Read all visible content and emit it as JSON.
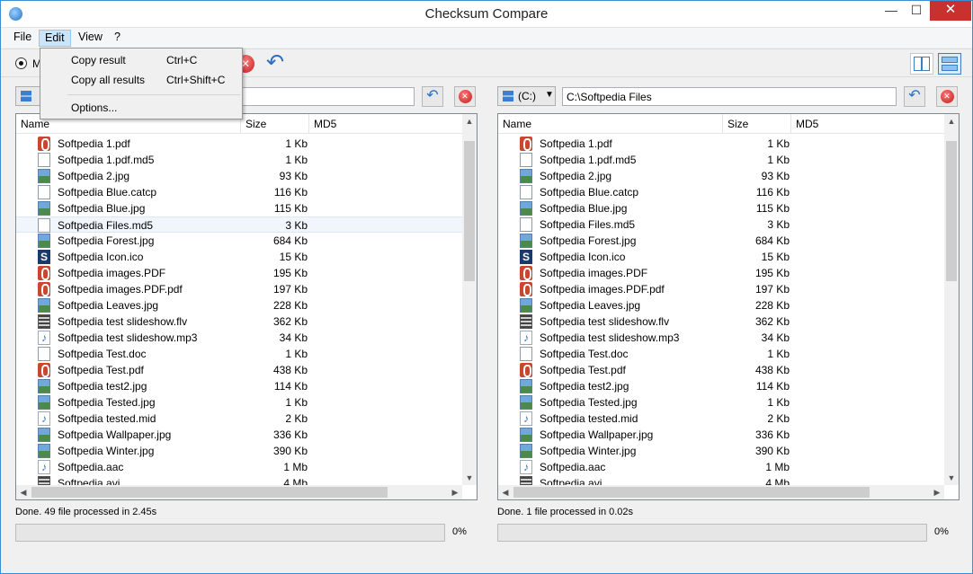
{
  "window": {
    "title": "Checksum Compare",
    "controls": {
      "minimize": "—",
      "maximize": "☐",
      "close": "✕"
    }
  },
  "menu": [
    "File",
    "Edit",
    "View",
    "?"
  ],
  "edit_menu": {
    "items": [
      {
        "label": "Copy result",
        "shortcut": "Ctrl+C"
      },
      {
        "label": "Copy all results",
        "shortcut": "Ctrl+Shift+C"
      },
      {
        "label": "Options...",
        "shortcut": ""
      }
    ]
  },
  "toolbar": {
    "mode_radio_label": "M"
  },
  "left_panel": {
    "drive": "",
    "path": "",
    "columns": [
      "Name",
      "Size",
      "MD5"
    ],
    "files": [
      {
        "name": "Softpedia 1.pdf",
        "size": "1 Kb",
        "icon": "pdf"
      },
      {
        "name": "Softpedia 1.pdf.md5",
        "size": "1 Kb",
        "icon": "file"
      },
      {
        "name": "Softpedia 2.jpg",
        "size": "93 Kb",
        "icon": "img"
      },
      {
        "name": "Softpedia Blue.catcp",
        "size": "116 Kb",
        "icon": "file"
      },
      {
        "name": "Softpedia Blue.jpg",
        "size": "115 Kb",
        "icon": "img"
      },
      {
        "name": "Softpedia Files.md5",
        "size": "3 Kb",
        "icon": "file"
      },
      {
        "name": "Softpedia Forest.jpg",
        "size": "684 Kb",
        "icon": "img"
      },
      {
        "name": "Softpedia Icon.ico",
        "size": "15 Kb",
        "icon": "ico"
      },
      {
        "name": "Softpedia images.PDF",
        "size": "195 Kb",
        "icon": "pdf"
      },
      {
        "name": "Softpedia images.PDF.pdf",
        "size": "197 Kb",
        "icon": "pdf"
      },
      {
        "name": "Softpedia Leaves.jpg",
        "size": "228 Kb",
        "icon": "img"
      },
      {
        "name": "Softpedia test slideshow.flv",
        "size": "362 Kb",
        "icon": "video"
      },
      {
        "name": "Softpedia test slideshow.mp3",
        "size": "34 Kb",
        "icon": "audio"
      },
      {
        "name": "Softpedia Test.doc",
        "size": "1 Kb",
        "icon": "file"
      },
      {
        "name": "Softpedia Test.pdf",
        "size": "438 Kb",
        "icon": "pdf"
      },
      {
        "name": "Softpedia test2.jpg",
        "size": "114 Kb",
        "icon": "img"
      },
      {
        "name": "Softpedia Tested.jpg",
        "size": "1 Kb",
        "icon": "img"
      },
      {
        "name": "Softpedia tested.mid",
        "size": "2 Kb",
        "icon": "audio"
      },
      {
        "name": "Softpedia Wallpaper.jpg",
        "size": "336 Kb",
        "icon": "img"
      },
      {
        "name": "Softpedia Winter.jpg",
        "size": "390 Kb",
        "icon": "img"
      },
      {
        "name": "Softpedia.aac",
        "size": "1 Mb",
        "icon": "audio"
      },
      {
        "name": "Softpedia.avi",
        "size": "4 Mb",
        "icon": "video"
      }
    ],
    "selected_index": 5,
    "status": "Done. 49 file processed in 2.45s",
    "progress_percent": 0,
    "progress_label": "0%"
  },
  "right_panel": {
    "drive": "(C:)",
    "path": "C:\\Softpedia Files",
    "columns": [
      "Name",
      "Size",
      "MD5"
    ],
    "files": [
      {
        "name": "Softpedia 1.pdf",
        "size": "1 Kb",
        "icon": "pdf"
      },
      {
        "name": "Softpedia 1.pdf.md5",
        "size": "1 Kb",
        "icon": "file"
      },
      {
        "name": "Softpedia 2.jpg",
        "size": "93 Kb",
        "icon": "img"
      },
      {
        "name": "Softpedia Blue.catcp",
        "size": "116 Kb",
        "icon": "file"
      },
      {
        "name": "Softpedia Blue.jpg",
        "size": "115 Kb",
        "icon": "img"
      },
      {
        "name": "Softpedia Files.md5",
        "size": "3 Kb",
        "icon": "file"
      },
      {
        "name": "Softpedia Forest.jpg",
        "size": "684 Kb",
        "icon": "img"
      },
      {
        "name": "Softpedia Icon.ico",
        "size": "15 Kb",
        "icon": "ico"
      },
      {
        "name": "Softpedia images.PDF",
        "size": "195 Kb",
        "icon": "pdf"
      },
      {
        "name": "Softpedia images.PDF.pdf",
        "size": "197 Kb",
        "icon": "pdf"
      },
      {
        "name": "Softpedia Leaves.jpg",
        "size": "228 Kb",
        "icon": "img"
      },
      {
        "name": "Softpedia test slideshow.flv",
        "size": "362 Kb",
        "icon": "video"
      },
      {
        "name": "Softpedia test slideshow.mp3",
        "size": "34 Kb",
        "icon": "audio"
      },
      {
        "name": "Softpedia Test.doc",
        "size": "1 Kb",
        "icon": "file"
      },
      {
        "name": "Softpedia Test.pdf",
        "size": "438 Kb",
        "icon": "pdf"
      },
      {
        "name": "Softpedia test2.jpg",
        "size": "114 Kb",
        "icon": "img"
      },
      {
        "name": "Softpedia Tested.jpg",
        "size": "1 Kb",
        "icon": "img"
      },
      {
        "name": "Softpedia tested.mid",
        "size": "2 Kb",
        "icon": "audio"
      },
      {
        "name": "Softpedia Wallpaper.jpg",
        "size": "336 Kb",
        "icon": "img"
      },
      {
        "name": "Softpedia Winter.jpg",
        "size": "390 Kb",
        "icon": "img"
      },
      {
        "name": "Softpedia.aac",
        "size": "1 Mb",
        "icon": "audio"
      },
      {
        "name": "Softpedia.avi",
        "size": "4 Mb",
        "icon": "video"
      }
    ],
    "selected_index": -1,
    "status": "Done. 1 file processed in 0.02s",
    "progress_percent": 0,
    "progress_label": "0%"
  },
  "colors": {
    "titlebar_close": "#c7312e",
    "selection": "#f1f6fc",
    "accent": "#2b6ec4"
  }
}
